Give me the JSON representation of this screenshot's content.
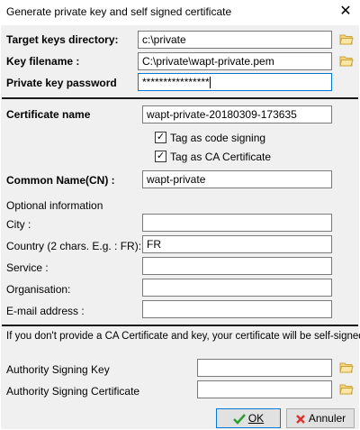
{
  "window": {
    "title": "Generate private key and self signed certificate",
    "close_glyph": "✕"
  },
  "fields": {
    "target_dir": {
      "label": "Target keys directory:",
      "value": "c:\\private"
    },
    "key_filename": {
      "label": "Key filename :",
      "value": "C:\\private\\wapt-private.pem"
    },
    "password": {
      "label": "Private key password",
      "value": "****************"
    },
    "cert_name": {
      "label": "Certificate name",
      "value": "wapt-private-20180309-173635"
    },
    "common_name": {
      "label": "Common Name(CN) :",
      "value": "wapt-private"
    },
    "city": {
      "label": "City :",
      "value": ""
    },
    "country": {
      "label": "Country (2 chars. E.g. : FR):",
      "value": "FR"
    },
    "service": {
      "label": "Service :",
      "value": ""
    },
    "organisation": {
      "label": "Organisation:",
      "value": ""
    },
    "email": {
      "label": "E-mail address :",
      "value": ""
    },
    "auth_key": {
      "label": "Authority Signing Key",
      "value": ""
    },
    "auth_cert": {
      "label": "Authority Signing Certificate",
      "value": ""
    }
  },
  "checkboxes": {
    "code_signing": {
      "label": "Tag as code signing",
      "checked": true
    },
    "ca_certificate": {
      "label": "Tag as CA Certificate",
      "checked": true
    }
  },
  "optional_info": "Optional information",
  "ca_notice": "If you don't provide a CA Certificate and key, your certificate will be self-signed.",
  "buttons": {
    "ok": "OK",
    "cancel": "Annuler"
  },
  "icons": {
    "folder": "folder-open-icon",
    "check": "checkmark-icon",
    "cancel": "cancel-icon"
  },
  "colors": {
    "folder_fill": "#f7d67a",
    "folder_stroke": "#c8a23c",
    "ok_check": "#2e9e2e",
    "cancel_x": "#d33"
  }
}
